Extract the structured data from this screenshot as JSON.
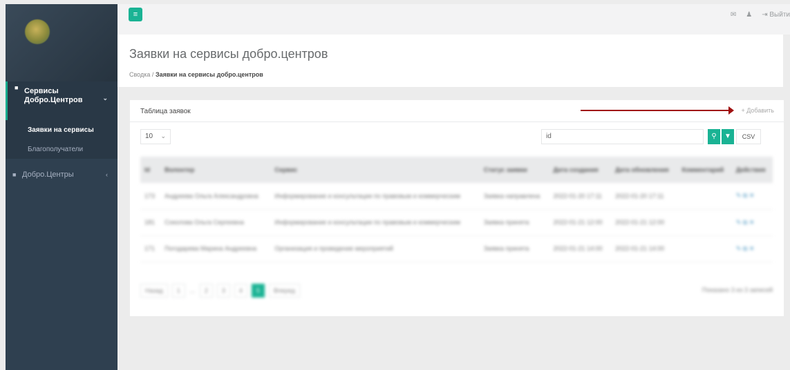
{
  "topbar": {
    "logout_label": "Выйти"
  },
  "sidebar": {
    "menu": {
      "services_label_line1": "Сервисы",
      "services_label_line2": "Добро.Центров",
      "sub_items": [
        "Заявки на сервисы",
        "Благополучатели"
      ],
      "dobro_label": "Добро.Центры"
    }
  },
  "page": {
    "title": "Заявки на сервисы добро.центров",
    "breadcrumb": {
      "home": "Сводка",
      "separator": "/",
      "current": "Заявки на сервисы добро.центров"
    }
  },
  "table_card": {
    "title": "Таблица заявок",
    "add_label": "Добавить",
    "page_size": "10",
    "search_value": "id",
    "csv_label": "CSV",
    "columns": [
      "Id",
      "Волонтер",
      "Сервис",
      "Статус заявки",
      "Дата создания",
      "Дата обновления",
      "Комментарий",
      "Действия"
    ],
    "rows": [
      [
        "173",
        "Андреева Ольга Александровна",
        "Информирование и консультации по правовым и коммерческим",
        "Заявка направлена",
        "2022-01-20 17:11",
        "2022-01-20 17:11",
        "",
        "✎ ⧉ ✕"
      ],
      [
        "181",
        "Соколова Ольга Сергеевна",
        "Информирование и консультации по правовым и коммерческим",
        "Заявка принята",
        "2022-01-21 12:00",
        "2022-01-21 12:00",
        "",
        "✎ ⧉ ✕"
      ],
      [
        "171",
        "Погодарева Марина Андреевна",
        "Организация и проведение мероприятий",
        "Заявка принята",
        "2022-01-21 14:00",
        "2022-01-21 14:00",
        "",
        "✎ ⧉ ✕"
      ]
    ],
    "pager": {
      "prev": "Назад",
      "pages": [
        "1",
        "…",
        "2",
        "3",
        "4",
        "5"
      ],
      "next": "Вперед",
      "info": "Показано 3 из 3 записей"
    }
  }
}
